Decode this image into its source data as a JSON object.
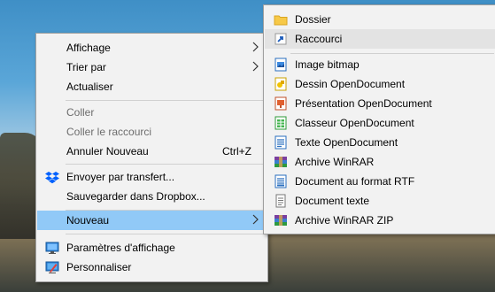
{
  "context_menu": {
    "items": [
      {
        "label": "Affichage",
        "submenu": true
      },
      {
        "label": "Trier par",
        "submenu": true
      },
      {
        "label": "Actualiser"
      },
      {
        "label": "Coller",
        "disabled": true
      },
      {
        "label": "Coller le raccourci",
        "disabled": true
      },
      {
        "label": "Annuler Nouveau",
        "shortcut": "Ctrl+Z"
      },
      {
        "label": "Envoyer par transfert...",
        "icon": "dropbox-icon"
      },
      {
        "label": "Sauvegarder dans Dropbox..."
      },
      {
        "label": "Nouveau",
        "submenu": true,
        "highlighted": true
      },
      {
        "label": "Paramètres d'affichage",
        "icon": "display-settings-icon"
      },
      {
        "label": "Personnaliser",
        "icon": "personalize-icon"
      }
    ]
  },
  "new_submenu": {
    "items": [
      {
        "label": "Dossier",
        "icon": "folder-icon"
      },
      {
        "label": "Raccourci",
        "icon": "shortcut-icon",
        "highlighted": true
      },
      {
        "label": "Image bitmap",
        "icon": "bitmap-image-icon"
      },
      {
        "label": "Dessin OpenDocument",
        "icon": "opendocument-drawing-icon"
      },
      {
        "label": "Présentation OpenDocument",
        "icon": "opendocument-presentation-icon"
      },
      {
        "label": "Classeur OpenDocument",
        "icon": "opendocument-spreadsheet-icon"
      },
      {
        "label": "Texte OpenDocument",
        "icon": "opendocument-text-icon"
      },
      {
        "label": "Archive WinRAR",
        "icon": "winrar-archive-icon"
      },
      {
        "label": "Document au format RTF",
        "icon": "rtf-document-icon"
      },
      {
        "label": "Document texte",
        "icon": "text-document-icon"
      },
      {
        "label": "Archive WinRAR ZIP",
        "icon": "winrar-zip-icon"
      }
    ]
  },
  "colors": {
    "menu_bg": "#f2f2f2",
    "menu_highlight": "#91c9f7",
    "submenu_highlight": "#e3e3e3",
    "disabled_text": "#6d6d6d"
  }
}
